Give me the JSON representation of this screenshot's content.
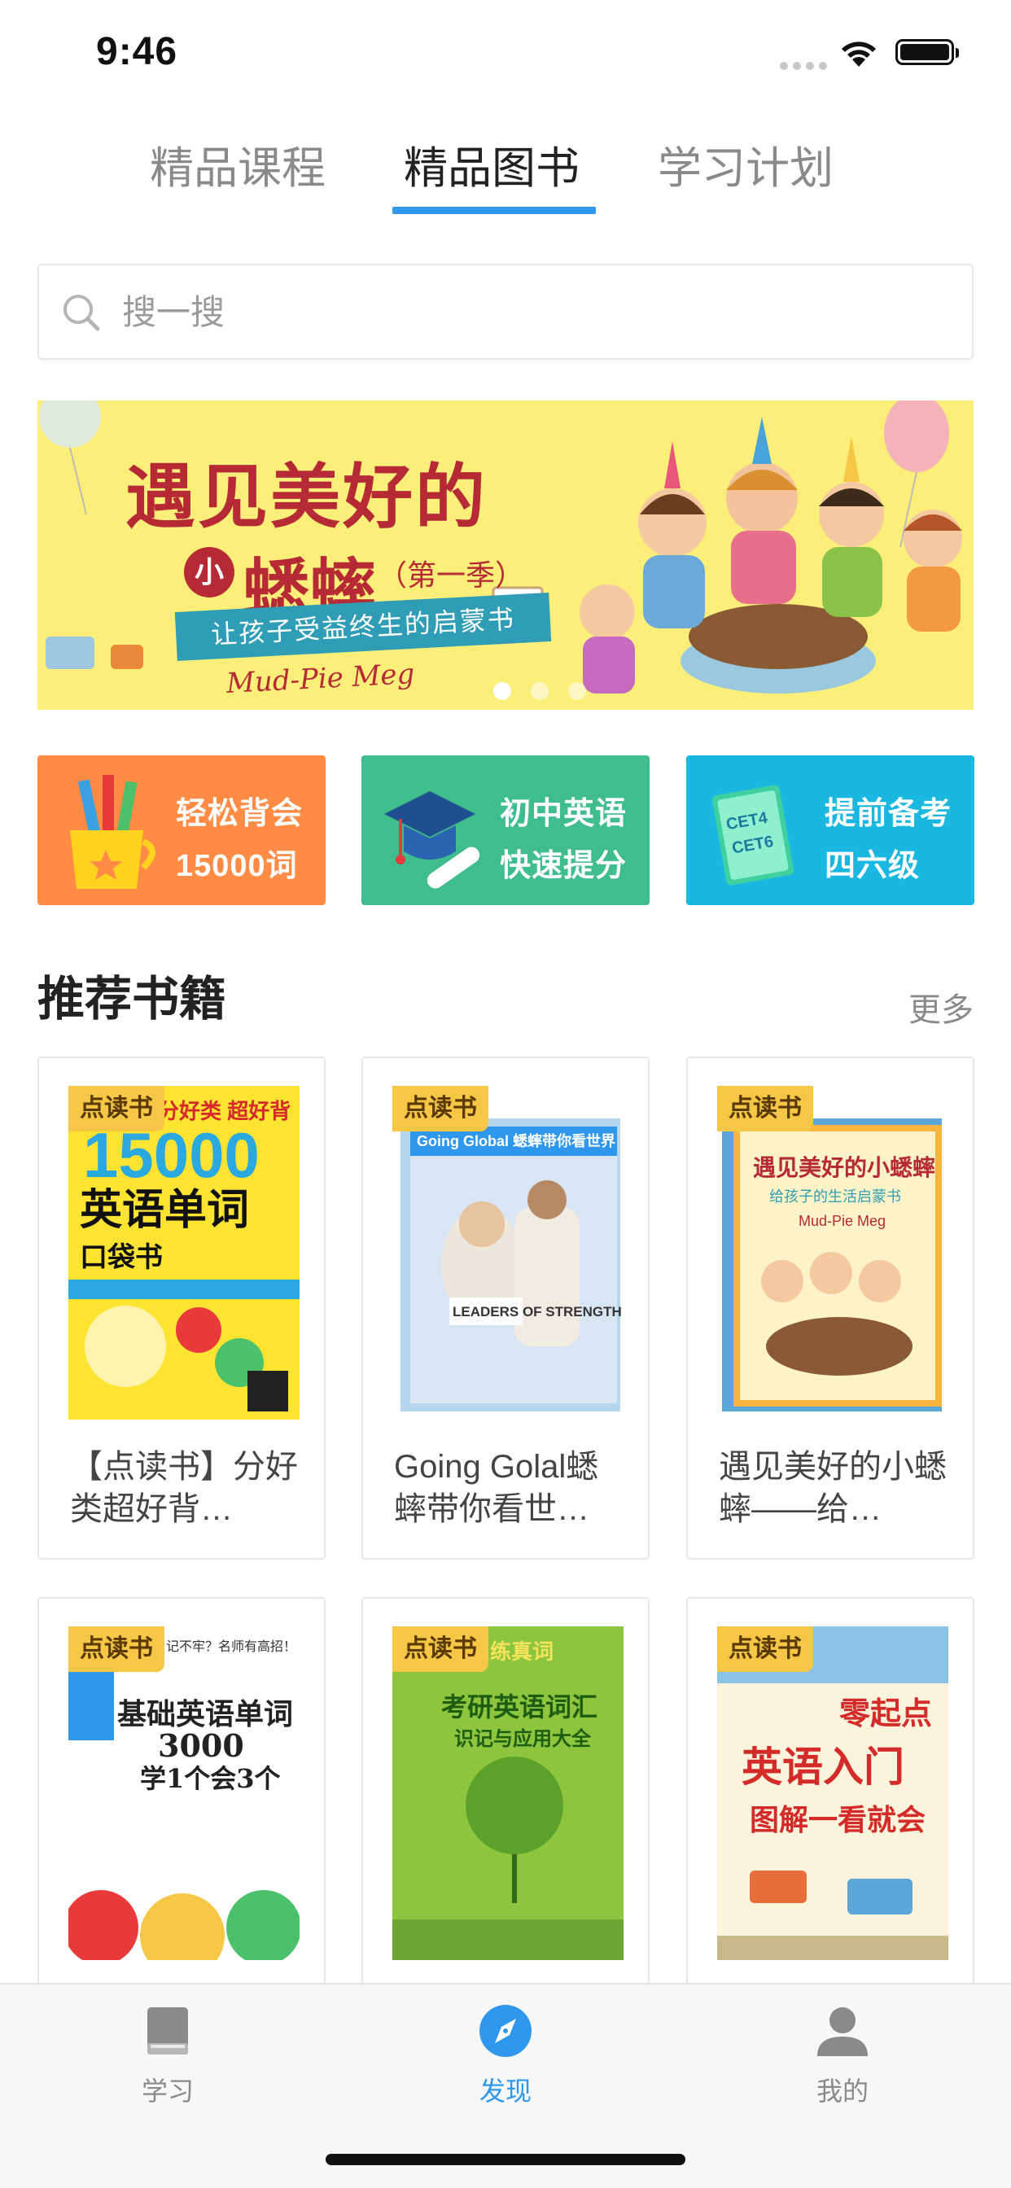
{
  "status_bar": {
    "time": "9:46"
  },
  "top_tabs": [
    {
      "label": "精品课程",
      "active": false
    },
    {
      "label": "精品图书",
      "active": true
    },
    {
      "label": "学习计划",
      "active": false
    }
  ],
  "search": {
    "placeholder": "搜一搜"
  },
  "banner": {
    "title": "遇见美好的",
    "badge": "小",
    "subtitle": "蟋蟀",
    "season": "（第一季）",
    "ribbon": "让孩子受益终生的启蒙书",
    "english": "Mud-Pie Meg",
    "page_count": 3,
    "active_page": 1
  },
  "features": [
    {
      "line1": "轻松背会",
      "line2": "15000词",
      "color": "#ff8b45",
      "icon": "pencil-cup-icon"
    },
    {
      "line1": "初中英语",
      "line2": "快速提分",
      "color": "#3fbd8e",
      "icon": "graduation-cap-icon"
    },
    {
      "line1": "提前备考",
      "line2": "四六级",
      "color": "#1ab8e0",
      "icon": "cet-book-icon",
      "icon_text": [
        "CET4",
        "CET6"
      ]
    }
  ],
  "section": {
    "title": "推荐书籍",
    "more": "更多"
  },
  "books": [
    {
      "tag": "点读书",
      "name": "【点读书】分好类超好背…",
      "cover": {
        "bg": "#fde433",
        "accent": "#d52a2a",
        "line1": "分好类 超好背",
        "line2": "15000",
        "line3": "英语单词",
        "line4": "口袋书"
      }
    },
    {
      "tag": "点读书",
      "name": "Going Golal蟋蟀带你看世…",
      "cover": {
        "bg": "#d7e6f2",
        "accent": "#2f98ec",
        "line1": "Going Global 蟋蟀带你看世界",
        "line2": "LEADERS OF STRENGTH"
      }
    },
    {
      "tag": "点读书",
      "name": "遇见美好的小蟋蟀——给…",
      "cover": {
        "bg": "#f6b53c",
        "accent": "#b62a35",
        "line1": "遇见美好的小蟋蟀",
        "line2": "给孩子的生活启蒙书",
        "line3": "Mud-Pie Meg"
      }
    },
    {
      "tag": "点读书",
      "cover": {
        "bg": "#ffffff",
        "accent": "#222",
        "line1": "记不牢？名师有高招！",
        "line2": "基础英语单词",
        "line3": "3000",
        "line4": "学1个会3个"
      }
    },
    {
      "tag": "点读书",
      "cover": {
        "bg": "#8cc63f",
        "accent": "#1e5c12",
        "line1": "练真词",
        "line2": "考研英语词汇",
        "line3": "识记与应用大全"
      }
    },
    {
      "tag": "点读书",
      "cover": {
        "bg": "#fbf3dc",
        "accent": "#d52a2a",
        "line1": "零起点",
        "line2": "英语入门",
        "line3": "图解一看就会"
      }
    }
  ],
  "tabbar": [
    {
      "label": "学习",
      "icon": "book-icon",
      "active": false
    },
    {
      "label": "发现",
      "icon": "compass-icon",
      "active": true
    },
    {
      "label": "我的",
      "icon": "user-icon",
      "active": false
    }
  ]
}
